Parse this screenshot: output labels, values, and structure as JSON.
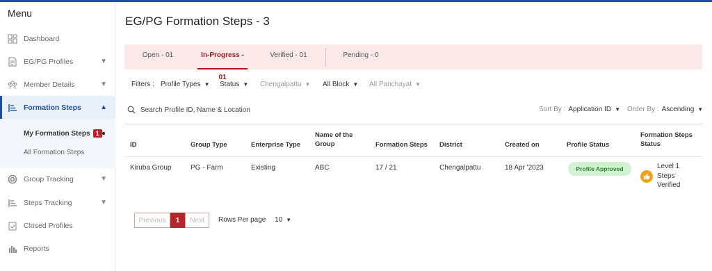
{
  "sidebar": {
    "title": "Menu",
    "items": [
      {
        "label": "Dashboard"
      },
      {
        "label": "EG/PG Profiles"
      },
      {
        "label": "Member Details"
      },
      {
        "label": "Formation Steps"
      },
      {
        "label": "Group Tracking"
      },
      {
        "label": "Steps Tracking"
      },
      {
        "label": "Closed Profiles"
      },
      {
        "label": "Reports"
      }
    ],
    "submenu": {
      "current": "My Formation Steps",
      "current_badge": "1",
      "other": "All Formation Steps"
    }
  },
  "page": {
    "title": "EG/PG Formation Steps -  3"
  },
  "tabs": [
    {
      "label": "Open - 01"
    },
    {
      "label": "In-Progress - 01"
    },
    {
      "label": "Verified - 01"
    },
    {
      "label": "Pending - 0"
    }
  ],
  "filters": {
    "label": "Filters :",
    "profile_types": "Profile Types",
    "status": "Status",
    "district": "Chengalpattu",
    "block": "All Block",
    "panchayat": "All Panchayat"
  },
  "search": {
    "placeholder": "Search Profile ID, Name & Location"
  },
  "sort": {
    "sort_label": "Sort By :",
    "sort_value": "Application ID",
    "order_label": "Order By :",
    "order_value": "Ascending"
  },
  "table": {
    "headers": {
      "id": "ID",
      "group_type": "Group Type",
      "enterprise_type": "Enterprise Type",
      "name_line1": "Name of the",
      "name_line2": "Group",
      "formation_steps": "Formation Steps",
      "district": "District",
      "created_on": "Created on",
      "profile_status": "Profile Status",
      "fs_status_line1": "Formation Steps",
      "fs_status_line2": "Status"
    },
    "rows": [
      {
        "id": "Kiruba Group",
        "group_type": "PG - Farm",
        "enterprise_type": "Existing",
        "name": "ABC",
        "formation_steps": "17 / 21",
        "district": "Chengalpattu",
        "created_on": "18 Apr '2023",
        "profile_status": "Profile Approved",
        "fs_status_line1": "Level 1",
        "fs_status_line2": "Steps",
        "fs_status_line3": "Verified"
      }
    ]
  },
  "pagination": {
    "previous": "Previous",
    "current": "1",
    "next": "Next",
    "rows_label": "Rows Per page",
    "rows_value": "10"
  },
  "colors": {
    "accent": "#b3262b",
    "nav_active": "#1f4e9e",
    "tabs_bg": "#fbe9e9",
    "approved_bg": "#d3f2d3"
  },
  "icons": [
    "dashboard-icon",
    "profiles-icon",
    "members-icon",
    "formation-steps-icon",
    "group-tracking-icon",
    "steps-tracking-icon",
    "closed-profiles-icon",
    "reports-icon",
    "search-icon",
    "thumbs-up-icon"
  ]
}
